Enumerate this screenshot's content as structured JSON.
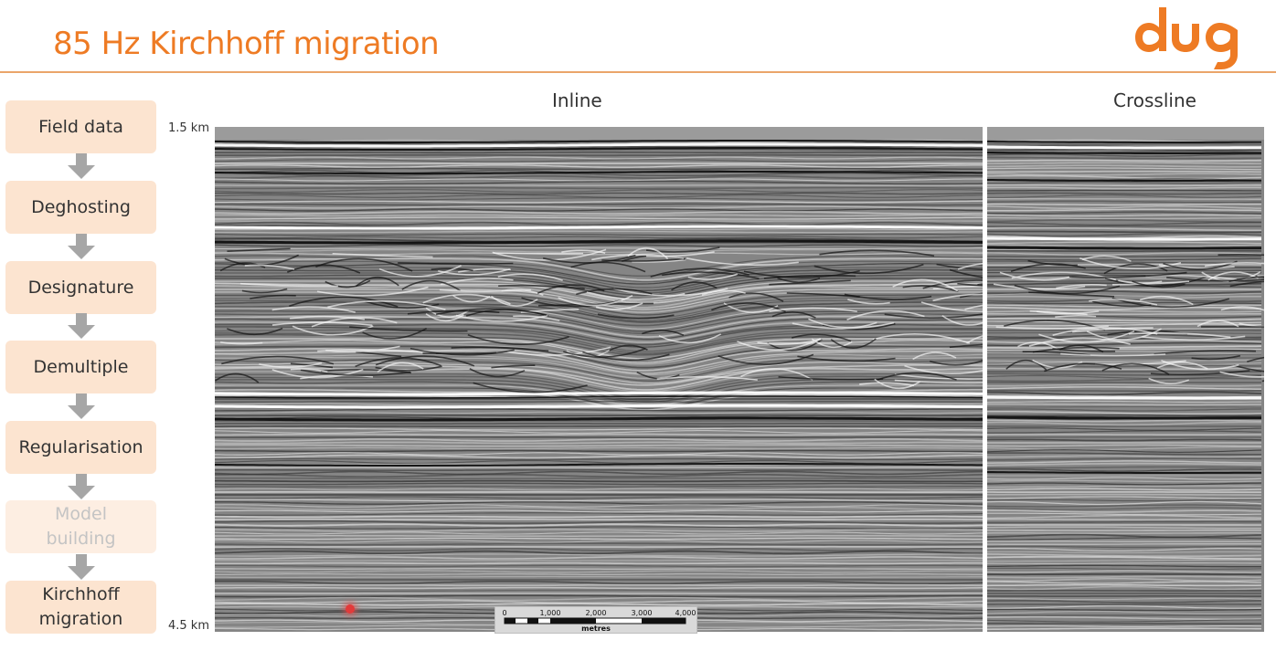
{
  "header": {
    "title": "85 Hz Kirchhoff migration",
    "logo_text": "dug",
    "accent_color": "#ee7b24"
  },
  "workflow": {
    "steps": [
      {
        "label": "Field data",
        "faded": false
      },
      {
        "label": "Deghosting",
        "faded": false
      },
      {
        "label": "Designature",
        "faded": false
      },
      {
        "label": "Demultiple",
        "faded": false
      },
      {
        "label": "Regularisation",
        "faded": false
      },
      {
        "label": "Model building",
        "faded": true
      },
      {
        "label": "Kirchhoff migration",
        "faded": false
      }
    ],
    "box_color": "#fce4d0",
    "arrow_color": "#a6a6a6"
  },
  "panels": {
    "inline_label": "Inline",
    "crossline_label": "Crossline"
  },
  "depth_axis": {
    "top": "1.5 km",
    "bottom": "4.5 km"
  },
  "scalebar": {
    "ticks": [
      "0",
      "1,000",
      "2,000",
      "3,000",
      "4,000"
    ],
    "unit": "metres"
  }
}
